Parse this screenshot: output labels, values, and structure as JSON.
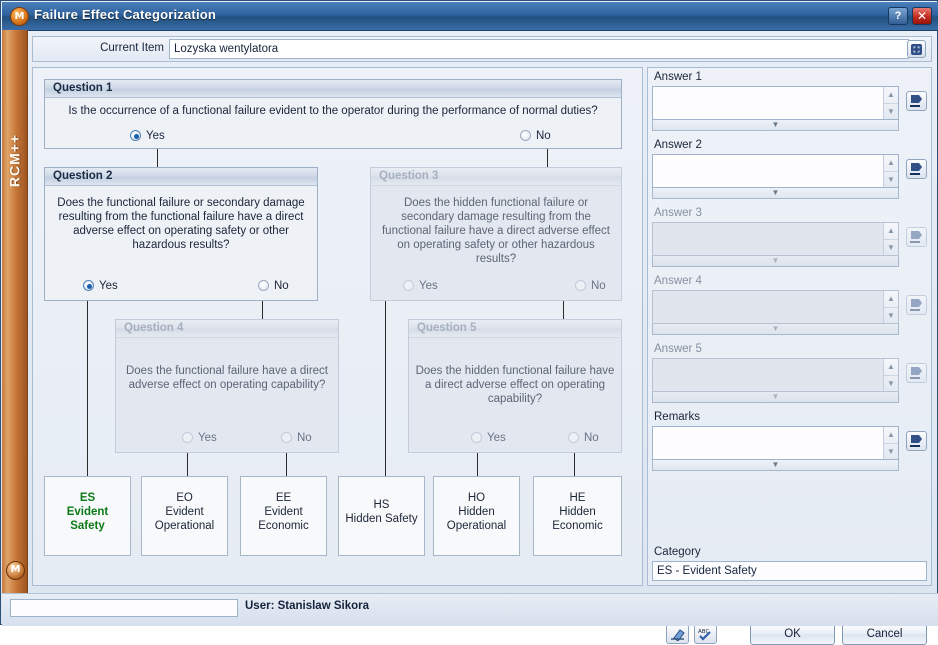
{
  "window": {
    "title": "Failure Effect Categorization",
    "logo_glyph": "M",
    "help_label": "?",
    "close_label": "✕"
  },
  "current_item": {
    "label": "Current Item",
    "value": "Lozyska wentylatora",
    "icon": "expand-window-icon"
  },
  "sidebar": {
    "product_name": "RCM++",
    "logo_glyph": "M"
  },
  "diagram": {
    "questions": [
      {
        "id": "q1",
        "header": "Question 1",
        "text": "Is the occurrence of a functional failure evident to the operator during the performance of normal duties?",
        "enabled": true,
        "yes_label": "Yes",
        "no_label": "No",
        "selected": "yes"
      },
      {
        "id": "q2",
        "header": "Question 2",
        "text": "Does the functional failure or secondary damage resulting from the functional failure have a direct adverse effect on operating safety or other hazardous results?",
        "enabled": true,
        "yes_label": "Yes",
        "no_label": "No",
        "selected": "yes"
      },
      {
        "id": "q3",
        "header": "Question 3",
        "text": "Does the hidden functional failure or secondary damage resulting from the functional failure have a direct adverse effect on operating safety or other hazardous results?",
        "enabled": false,
        "yes_label": "Yes",
        "no_label": "No",
        "selected": "none"
      },
      {
        "id": "q4",
        "header": "Question 4",
        "text": "Does the functional failure have a direct adverse effect on operating capability?",
        "enabled": false,
        "yes_label": "Yes",
        "no_label": "No",
        "selected": "none"
      },
      {
        "id": "q5",
        "header": "Question 5",
        "text": "Does the hidden functional failure have a direct adverse effect on operating capability?",
        "enabled": false,
        "yes_label": "Yes",
        "no_label": "No",
        "selected": "none"
      }
    ],
    "results": [
      {
        "code": "ES",
        "line1": "Evident",
        "line2": "Safety",
        "active": true
      },
      {
        "code": "EO",
        "line1": "Evident",
        "line2": "Operational",
        "active": false
      },
      {
        "code": "EE",
        "line1": "Evident",
        "line2": "Economic",
        "active": false
      },
      {
        "code": "HS",
        "line1": "Hidden Safety",
        "line2": "",
        "active": false
      },
      {
        "code": "HO",
        "line1": "Hidden",
        "line2": "Operational",
        "active": false
      },
      {
        "code": "HE",
        "line1": "Hidden",
        "line2": "Economic",
        "active": false
      }
    ],
    "active_color": "#0d7a17"
  },
  "answers_panel": {
    "fields": [
      {
        "label": "Answer 1",
        "value": "",
        "enabled": true,
        "button_icon": "insert-reference-icon",
        "expander_icon": "chevron-down-icon"
      },
      {
        "label": "Answer 2",
        "value": "",
        "enabled": true,
        "button_icon": "insert-reference-icon",
        "expander_icon": "chevron-down-icon"
      },
      {
        "label": "Answer 3",
        "value": "",
        "enabled": false,
        "button_icon": "insert-reference-icon",
        "expander_icon": "chevron-down-icon"
      },
      {
        "label": "Answer 4",
        "value": "",
        "enabled": false,
        "button_icon": "insert-reference-icon",
        "expander_icon": "chevron-down-icon"
      },
      {
        "label": "Answer 5",
        "value": "",
        "enabled": false,
        "button_icon": "insert-reference-icon",
        "expander_icon": "chevron-down-icon"
      },
      {
        "label": "Remarks",
        "value": "",
        "enabled": true,
        "button_icon": "insert-reference-icon",
        "expander_icon": "chevron-down-icon"
      }
    ],
    "category": {
      "label": "Category",
      "value": "ES  - Evident Safety",
      "arrow_icon": "chevron-down-icon"
    },
    "buttons": {
      "eraser_icon": "eraser-icon",
      "spellcheck_icon": "spellcheck-icon",
      "ok_label": "OK",
      "cancel_label": "Cancel"
    }
  },
  "statusbar": {
    "progress_value": "",
    "user_text": "User: Stanislaw Sikora"
  }
}
